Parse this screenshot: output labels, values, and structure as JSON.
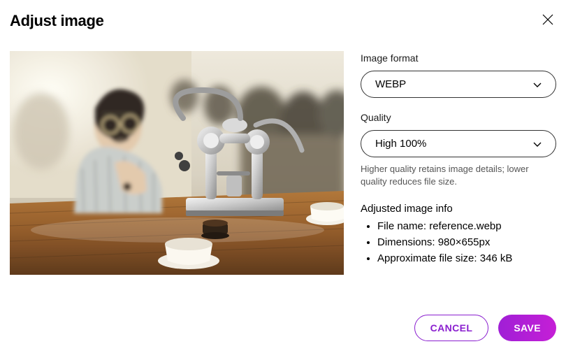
{
  "dialog": {
    "title": "Adjust image"
  },
  "format_field": {
    "label": "Image format",
    "value": "WEBP"
  },
  "quality_field": {
    "label": "Quality",
    "value": "High 100%",
    "hint": "Higher quality retains image details; lower quality reduces file size."
  },
  "info": {
    "heading": "Adjusted image info",
    "items": [
      {
        "label": "File name:",
        "value": "reference.webp"
      },
      {
        "label": "Dimensions:",
        "value": "980×655px"
      },
      {
        "label": "Approximate file size:",
        "value": "346 kB"
      }
    ]
  },
  "footer": {
    "cancel": "CANCEL",
    "save": "SAVE"
  }
}
